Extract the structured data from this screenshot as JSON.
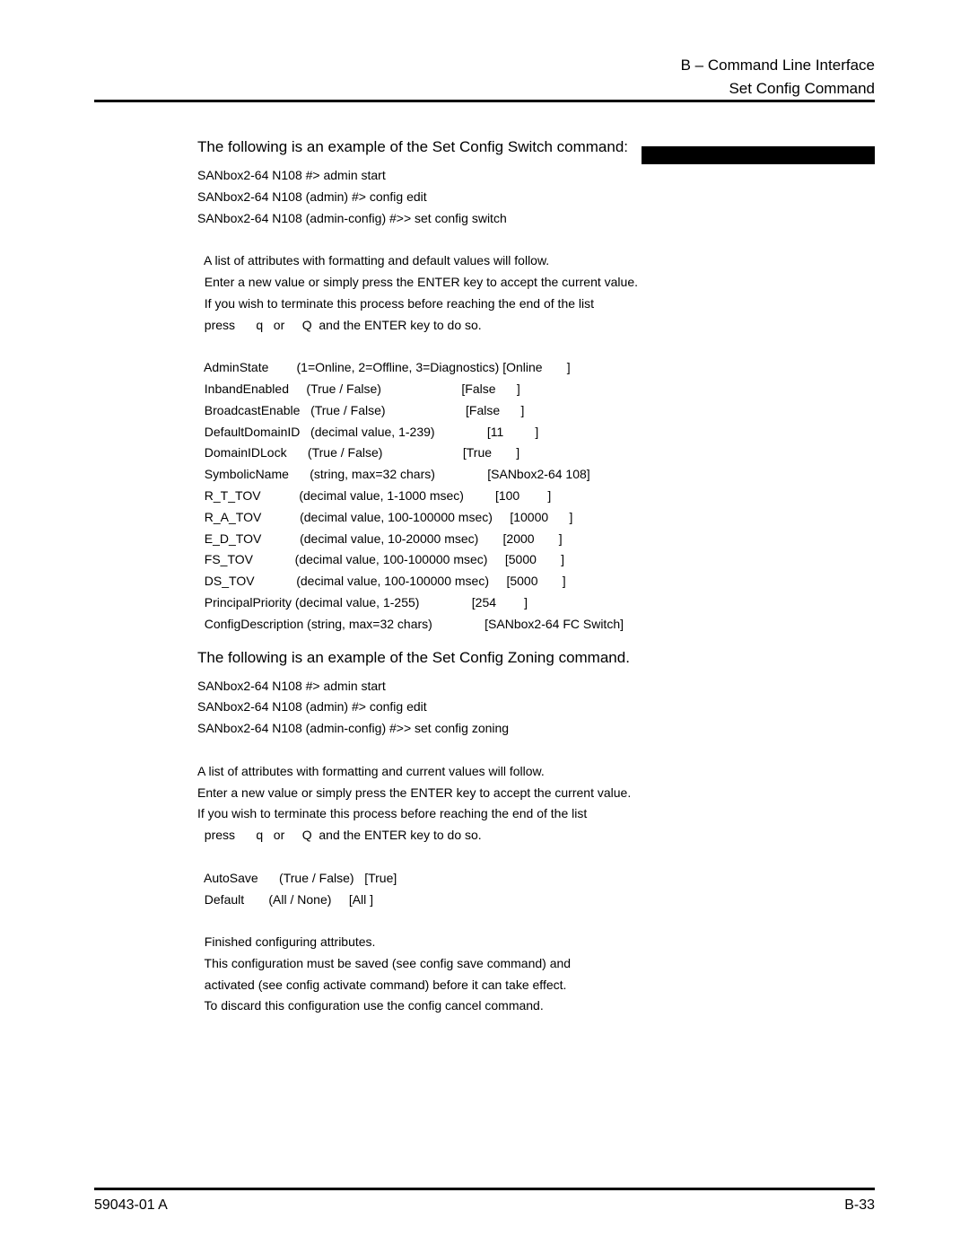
{
  "header": {
    "line1": "B – Command Line Interface",
    "line2": "Set Config Command"
  },
  "body": {
    "intro1": "The following is an example of the Set Config Switch command:",
    "block1": "SANbox2-64 N108 #> admin start\nSANbox2-64 N108 (admin) #> config edit\nSANbox2-64 N108 (admin-config) #>> set config switch\n\n  A list of attributes with formatting and default values will follow.\n  Enter a new value or simply press the ENTER key to accept the current value.\n  If you wish to terminate this process before reaching the end of the list\n  press      q   or     Q  and the ENTER key to do so.\n\n  AdminState        (1=Online, 2=Offline, 3=Diagnostics) [Online       ]\n  InbandEnabled     (True / False)                       [False      ]\n  BroadcastEnable   (True / False)                       [False      ]\n  DefaultDomainID   (decimal value, 1-239)               [11         ]\n  DomainIDLock      (True / False)                       [True       ]\n  SymbolicName      (string, max=32 chars)               [SANbox2-64 108]\n  R_T_TOV           (decimal value, 1-1000 msec)         [100        ]\n  R_A_TOV           (decimal value, 100-100000 msec)     [10000      ]\n  E_D_TOV           (decimal value, 10-20000 msec)       [2000       ]\n  FS_TOV            (decimal value, 100-100000 msec)     [5000       ]\n  DS_TOV            (decimal value, 100-100000 msec)     [5000       ]\n  PrincipalPriority (decimal value, 1-255)               [254        ]\n  ConfigDescription (string, max=32 chars)               [SANbox2-64 FC Switch]",
    "intro2": "The following is an example of the Set Config Zoning command.",
    "block2": "SANbox2-64 N108 #> admin start\nSANbox2-64 N108 (admin) #> config edit\nSANbox2-64 N108 (admin-config) #>> set config zoning\n\nA list of attributes with formatting and current values will follow.\nEnter a new value or simply press the ENTER key to accept the current value.\nIf you wish to terminate this process before reaching the end of the list\n  press      q   or     Q  and the ENTER key to do so.\n\n  AutoSave      (True / False)   [True]\n  Default       (All / None)     [All ]\n\n  Finished configuring attributes.\n  This configuration must be saved (see config save command) and\n  activated (see config activate command) before it can take effect.\n  To discard this configuration use the config cancel command."
  },
  "footer": {
    "left": "59043-01  A",
    "right": "B-33"
  }
}
